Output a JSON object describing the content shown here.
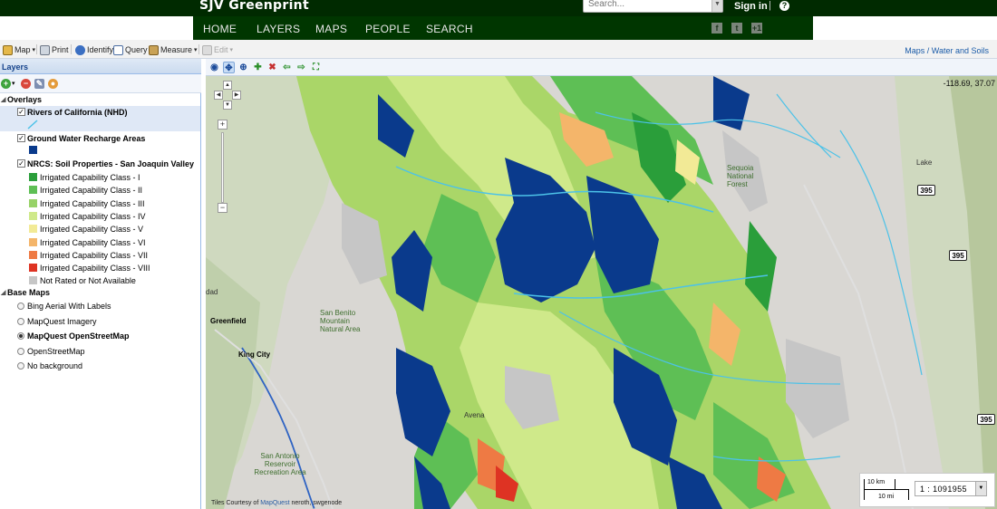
{
  "header": {
    "brand": "SJV Greenprint",
    "search_placeholder": "Search...",
    "sign_in": "Sign in",
    "separator": "|",
    "help": "?"
  },
  "nav": {
    "items": [
      "HOME",
      "LAYERS",
      "MAPS",
      "PEOPLE",
      "SEARCH"
    ],
    "social": [
      "f",
      "t",
      "+1"
    ]
  },
  "toolbar": {
    "map": "Map",
    "print": "Print",
    "identify": "Identify",
    "query": "Query",
    "measure": "Measure",
    "edit": "Edit",
    "crumb_maps": "Maps",
    "crumb_sep": " / ",
    "crumb_current": "Water and Soils"
  },
  "panel": {
    "title": "Layers",
    "overlays_label": "Overlays",
    "rivers": "Rivers of California (NHD)",
    "groundwater": "Ground Water Recharge Areas",
    "nrcs": "NRCS: Soil Properties - San Joaquin Valley",
    "classes": [
      {
        "label": "Irrigated Capability Class - I",
        "color": "#2a9e3a"
      },
      {
        "label": "Irrigated Capability Class - II",
        "color": "#5ebf55"
      },
      {
        "label": "Irrigated Capability Class - III",
        "color": "#97d267"
      },
      {
        "label": "Irrigated Capability Class - IV",
        "color": "#cfe98a"
      },
      {
        "label": "Irrigated Capability Class - V",
        "color": "#f2ea96"
      },
      {
        "label": "Irrigated Capability Class - VI",
        "color": "#f4b56a"
      },
      {
        "label": "Irrigated Capability Class - VII",
        "color": "#ee7a44"
      },
      {
        "label": "Irrigated Capability Class - VIII",
        "color": "#de3323"
      },
      {
        "label": "Not Rated or Not Available",
        "color": "#c6c6c6"
      }
    ],
    "basemaps_label": "Base Maps",
    "basemaps": [
      "Bing Aerial With Labels",
      "MapQuest Imagery",
      "MapQuest OpenStreetMap",
      "OpenStreetMap",
      "No background"
    ],
    "groundwater_color": "#0a3a8c",
    "rivers_color": "#4cc2e8"
  },
  "map": {
    "coords": "-118.69, 37.07",
    "labels": {
      "greenfield": "Greenfield",
      "king_city": "King City",
      "san_benito": "San Benito Mountain Natural Area",
      "san_antonio": "San Antonio Reservoir Recreation Area",
      "sequoia": "Sequoia National Forest",
      "dad": "dad",
      "lake": "Lake",
      "avena": "Avena"
    },
    "shields": [
      "395",
      "395",
      "395"
    ],
    "scale_km": "10 km",
    "scale_mi": "10 mi",
    "scale_ratio": "1 : 1091955",
    "attribution_prefix": "Tiles Courtesy of",
    "attribution_link": "MapQuest",
    "attribution_suffix": "neroth, swgenode"
  }
}
